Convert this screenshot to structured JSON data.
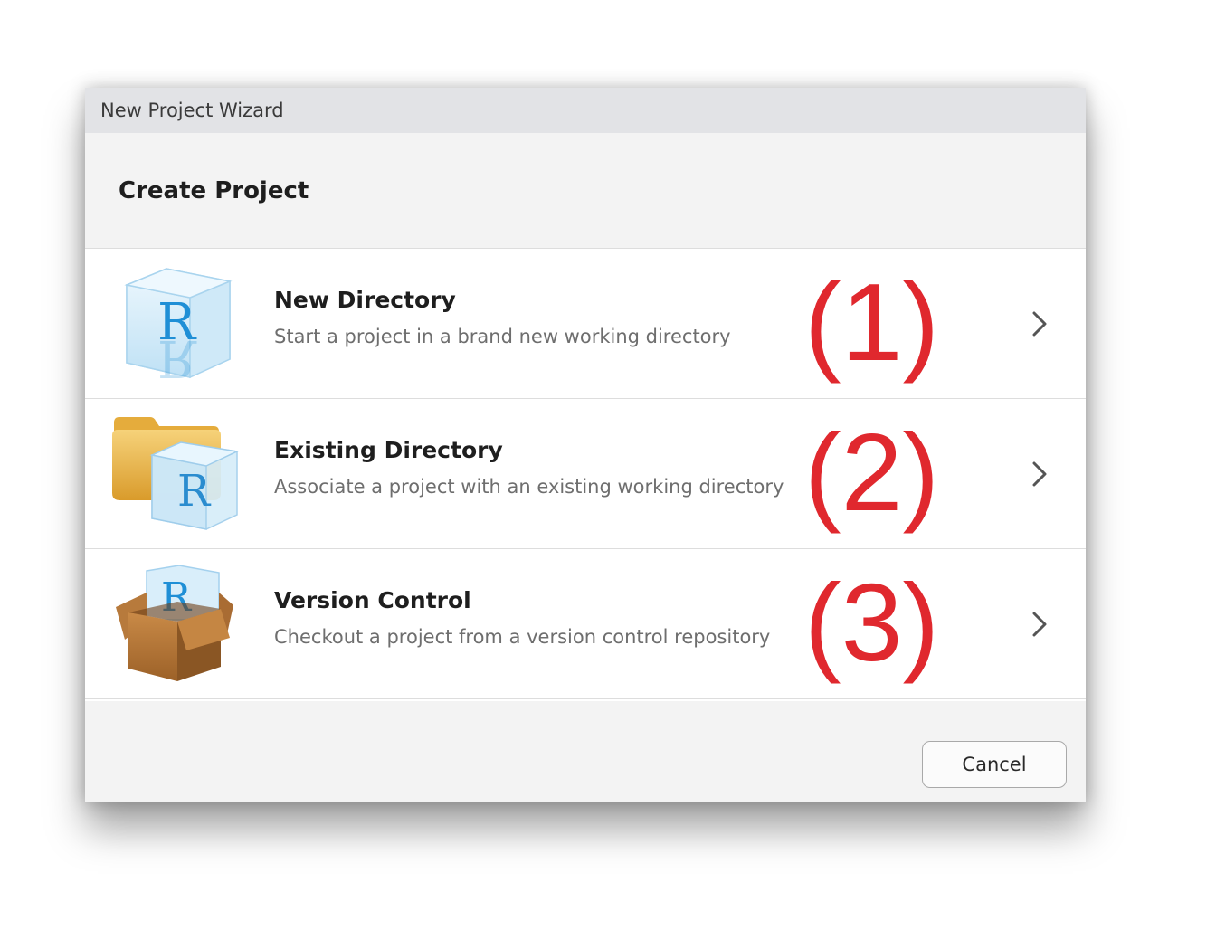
{
  "window": {
    "title": "New Project Wizard"
  },
  "header": {
    "title": "Create Project"
  },
  "options": [
    {
      "name": "New Directory",
      "description": "Start a project in a brand new working directory",
      "annotation": "(1)",
      "icon": "r-project-cube-icon"
    },
    {
      "name": "Existing Directory",
      "description": "Associate a project with an existing working directory",
      "annotation": "(2)",
      "icon": "folder-r-project-icon"
    },
    {
      "name": "Version Control",
      "description": "Checkout a project from a version control repository",
      "annotation": "(3)",
      "icon": "cardboard-box-r-project-icon"
    }
  ],
  "footer": {
    "cancel_label": "Cancel"
  },
  "colors": {
    "annotation": "#e0282e",
    "titlebar": "#e2e3e6",
    "header_bg": "#f3f3f3"
  }
}
